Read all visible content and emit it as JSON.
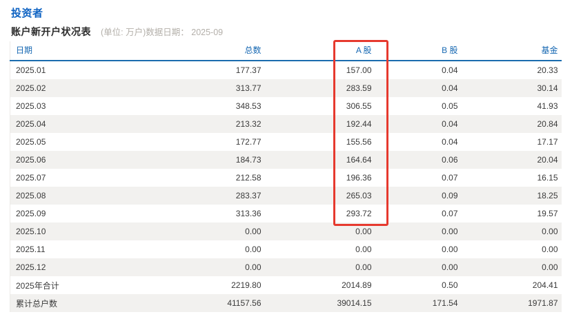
{
  "page": {
    "section_title": "投资者",
    "table_title": "账户新开户状况表",
    "table_note": "(单位: 万户)数据日期： 2025-09"
  },
  "table": {
    "columns": [
      "日期",
      "总数",
      "A 股",
      "B 股",
      "基金"
    ],
    "rows": [
      [
        "2025.01",
        "177.37",
        "157.00",
        "0.04",
        "20.33"
      ],
      [
        "2025.02",
        "313.77",
        "283.59",
        "0.04",
        "30.14"
      ],
      [
        "2025.03",
        "348.53",
        "306.55",
        "0.05",
        "41.93"
      ],
      [
        "2025.04",
        "213.32",
        "192.44",
        "0.04",
        "20.84"
      ],
      [
        "2025.05",
        "172.77",
        "155.56",
        "0.04",
        "17.17"
      ],
      [
        "2025.06",
        "184.73",
        "164.64",
        "0.06",
        "20.04"
      ],
      [
        "2025.07",
        "212.58",
        "196.36",
        "0.07",
        "16.15"
      ],
      [
        "2025.08",
        "283.37",
        "265.03",
        "0.09",
        "18.25"
      ],
      [
        "2025.09",
        "313.36",
        "293.72",
        "0.07",
        "19.57"
      ],
      [
        "2025.10",
        "0.00",
        "0.00",
        "0.00",
        "0.00"
      ],
      [
        "2025.11",
        "0.00",
        "0.00",
        "0.00",
        "0.00"
      ],
      [
        "2025.12",
        "0.00",
        "0.00",
        "0.00",
        "0.00"
      ],
      [
        "2025年合计",
        "2219.80",
        "2014.89",
        "0.50",
        "204.41"
      ],
      [
        "累计总户数",
        "41157.56",
        "39014.15",
        "171.54",
        "1971.87"
      ]
    ]
  },
  "annotation": {
    "highlighted_column": "A 股",
    "highlight_color": "#e6392e"
  },
  "colors": {
    "section_title_blue": "#0d62c2",
    "header_blue": "#1567b2",
    "header_rule_blue": "#1a6cae",
    "zebra_row_gray": "#f2f1ef",
    "body_text": "#3a3a3a",
    "note_gray": "#b3afa9"
  }
}
